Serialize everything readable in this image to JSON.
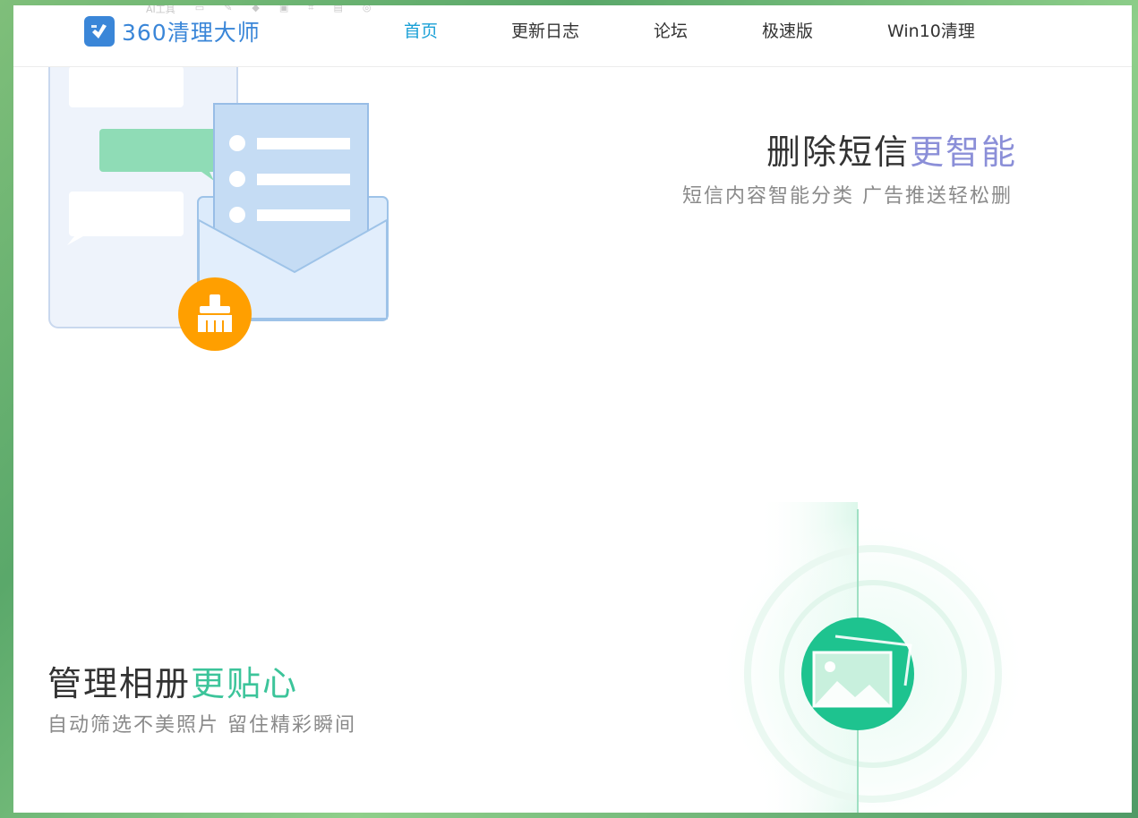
{
  "header": {
    "logo_text": "360清理大师",
    "logo_icon": "broom-shield-icon",
    "ghost_toolbar": [
      "AI工具",
      "",
      "",
      "",
      "",
      "",
      "",
      ""
    ]
  },
  "nav": {
    "items": [
      {
        "label": "首页",
        "active": true
      },
      {
        "label": "更新日志",
        "active": false
      },
      {
        "label": "论坛",
        "active": false
      },
      {
        "label": "极速版",
        "active": false
      },
      {
        "label": "Win10清理",
        "active": false
      }
    ]
  },
  "feature_sms": {
    "title_main": "删除短信",
    "title_highlight": "更智能",
    "subtitle": "短信内容智能分类  广告推送轻松删",
    "icon": "sms-clean-illustration",
    "badge_icon": "broom-icon"
  },
  "feature_album": {
    "title_main": "管理相册",
    "title_highlight": "更贴心",
    "subtitle": "自动筛选不美照片  留住精彩瞬间",
    "icon": "photo-album-icon"
  },
  "colors": {
    "brand_blue": "#3a86d8",
    "nav_active": "#1aa0d6",
    "sms_highlight": "#8b8fd8",
    "album_highlight": "#3cc49a",
    "broom_badge": "#ff9f00",
    "album_green": "#1ec38f"
  }
}
